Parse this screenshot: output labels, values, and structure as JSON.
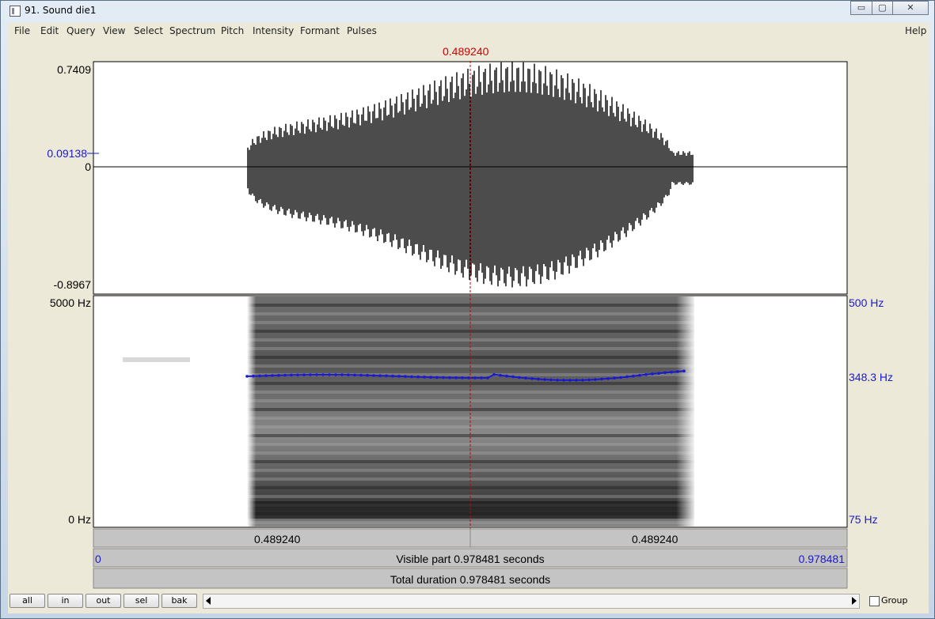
{
  "window": {
    "title": "91. Sound die1",
    "controls": {
      "minimize": "▭",
      "maximize": "▢",
      "close": "✕"
    }
  },
  "menu": {
    "items": [
      "File",
      "Edit",
      "Query",
      "View",
      "Select",
      "Spectrum",
      "Pitch",
      "Intensity",
      "Formant",
      "Pulses"
    ],
    "help": "Help"
  },
  "cursor": {
    "time": "0.489240"
  },
  "waveform": {
    "max": "0.7409",
    "cursor_value": "0.09138",
    "zero": "0",
    "min": "-0.8967"
  },
  "spectrogram": {
    "top_freq": "5000 Hz",
    "bottom_freq": "0 Hz"
  },
  "pitch": {
    "top": "500 Hz",
    "cursor_value": "348.3 Hz",
    "bottom": "75 Hz",
    "color": "#1a1acc"
  },
  "timebar": {
    "left_segment": "0.489240",
    "right_segment": "0.489240",
    "visible_start": "0",
    "visible_text": "Visible part 0.978481 seconds",
    "visible_end": "0.978481",
    "total_text": "Total duration 0.978481 seconds"
  },
  "buttons": {
    "all": "all",
    "in": "in",
    "out": "out",
    "sel": "sel",
    "bak": "bak"
  },
  "group_label": "Group",
  "colors": {
    "cursor": "#cc0000",
    "axis_blue": "#1a1acc",
    "panel_bg": "#ece9d8"
  }
}
